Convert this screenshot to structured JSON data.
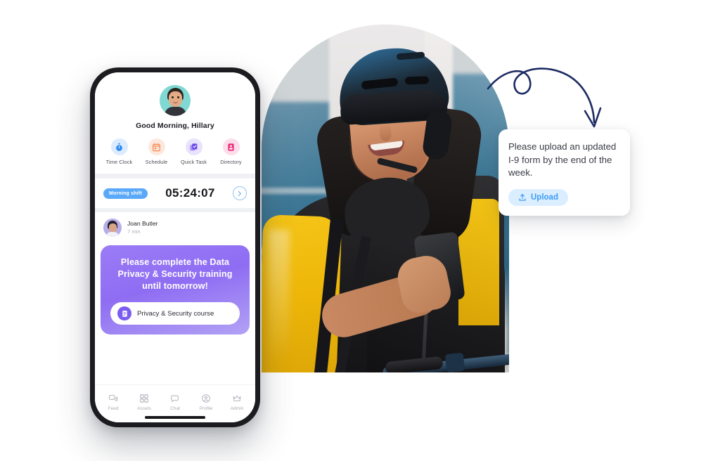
{
  "phone": {
    "greeting": "Good Morning, Hillary",
    "avatar_name": "hillary-avatar",
    "quick_actions": [
      {
        "label": "Time Clock",
        "icon": "stopwatch-icon",
        "bg": "#dcebfd",
        "fg": "#2f8cf5"
      },
      {
        "label": "Schedule",
        "icon": "calendar-icon",
        "bg": "#fde8de",
        "fg": "#f4884f"
      },
      {
        "label": "Quick Task",
        "icon": "task-check-icon",
        "bg": "#e8e2fd",
        "fg": "#7b5cf0"
      },
      {
        "label": "Directory",
        "icon": "id-card-icon",
        "bg": "#fcdde9",
        "fg": "#ec2a78"
      }
    ],
    "timer": {
      "shift_badge": "Morning shift",
      "value": "05:24:07",
      "go_icon": "chevron-right-icon"
    },
    "post": {
      "author": "Joan Butler",
      "time": "7 min"
    },
    "promo": {
      "message": "Please complete the Data Privacy & Security training until tomorrow!",
      "button_label": "Privacy & Security course",
      "button_icon": "document-list-icon"
    },
    "tabs": [
      {
        "label": "Feed",
        "icon": "feed-icon"
      },
      {
        "label": "Assets",
        "icon": "grid-icon"
      },
      {
        "label": "Chat",
        "icon": "chat-bubble-icon"
      },
      {
        "label": "Profile",
        "icon": "person-circle-icon"
      },
      {
        "label": "Admin",
        "icon": "crown-icon"
      }
    ]
  },
  "callout": {
    "message": "Please upload an updated I-9 form by the end of the week.",
    "upload_label": "Upload",
    "upload_icon": "upload-icon"
  },
  "hero": {
    "alt": "delivery cyclist with helmet and yellow bag holding phone"
  },
  "colors": {
    "accent_blue": "#3d9cf5",
    "accent_purple": "#8f6df3",
    "badge_blue": "#5aa9f8",
    "arrow_navy": "#1d2b63",
    "upload_bg": "#dbeeff"
  }
}
